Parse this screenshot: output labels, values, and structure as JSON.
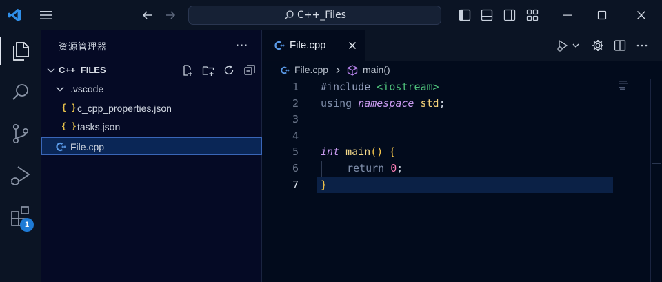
{
  "titlebar": {
    "search_text": "C++_Files"
  },
  "activity": {
    "extensions_badge": "1"
  },
  "sidebar": {
    "title": "资源管理器",
    "more": "···",
    "folder_name": "C++_FILES",
    "items": [
      {
        "label": ".vscode",
        "kind": "folder",
        "icon": "chevron-down-icon"
      },
      {
        "label": "c_cpp_properties.json",
        "kind": "json",
        "icon_text": "{ }"
      },
      {
        "label": "tasks.json",
        "kind": "json",
        "icon_text": "{ }"
      },
      {
        "label": "File.cpp",
        "kind": "cpp",
        "selected": true
      }
    ]
  },
  "tabs": [
    {
      "label": "File.cpp",
      "active": true
    }
  ],
  "breadcrumb": {
    "file": "File.cpp",
    "symbol": "main()"
  },
  "editor": {
    "current_line": 7,
    "lines": [
      {
        "n": "1"
      },
      {
        "n": "2"
      },
      {
        "n": "3"
      },
      {
        "n": "4"
      },
      {
        "n": "5"
      },
      {
        "n": "6"
      },
      {
        "n": "7"
      }
    ],
    "tokens": {
      "l1_pp": "#include",
      "l1_inc": "<iostream>",
      "l2_using": "using",
      "l2_namespace": "namespace",
      "l2_std": "std",
      "l2_semi": ";",
      "l5_int": "int",
      "l5_main": "main",
      "l5_paren": "()",
      "l5_brace": "{",
      "l6_return": "return",
      "l6_zero": "0",
      "l6_semi": ";",
      "l7_brace": "}"
    }
  },
  "colors": {
    "accent": "#1e7bd6",
    "selection_border": "#3a66b8",
    "json_icon": "#e5c04a"
  }
}
